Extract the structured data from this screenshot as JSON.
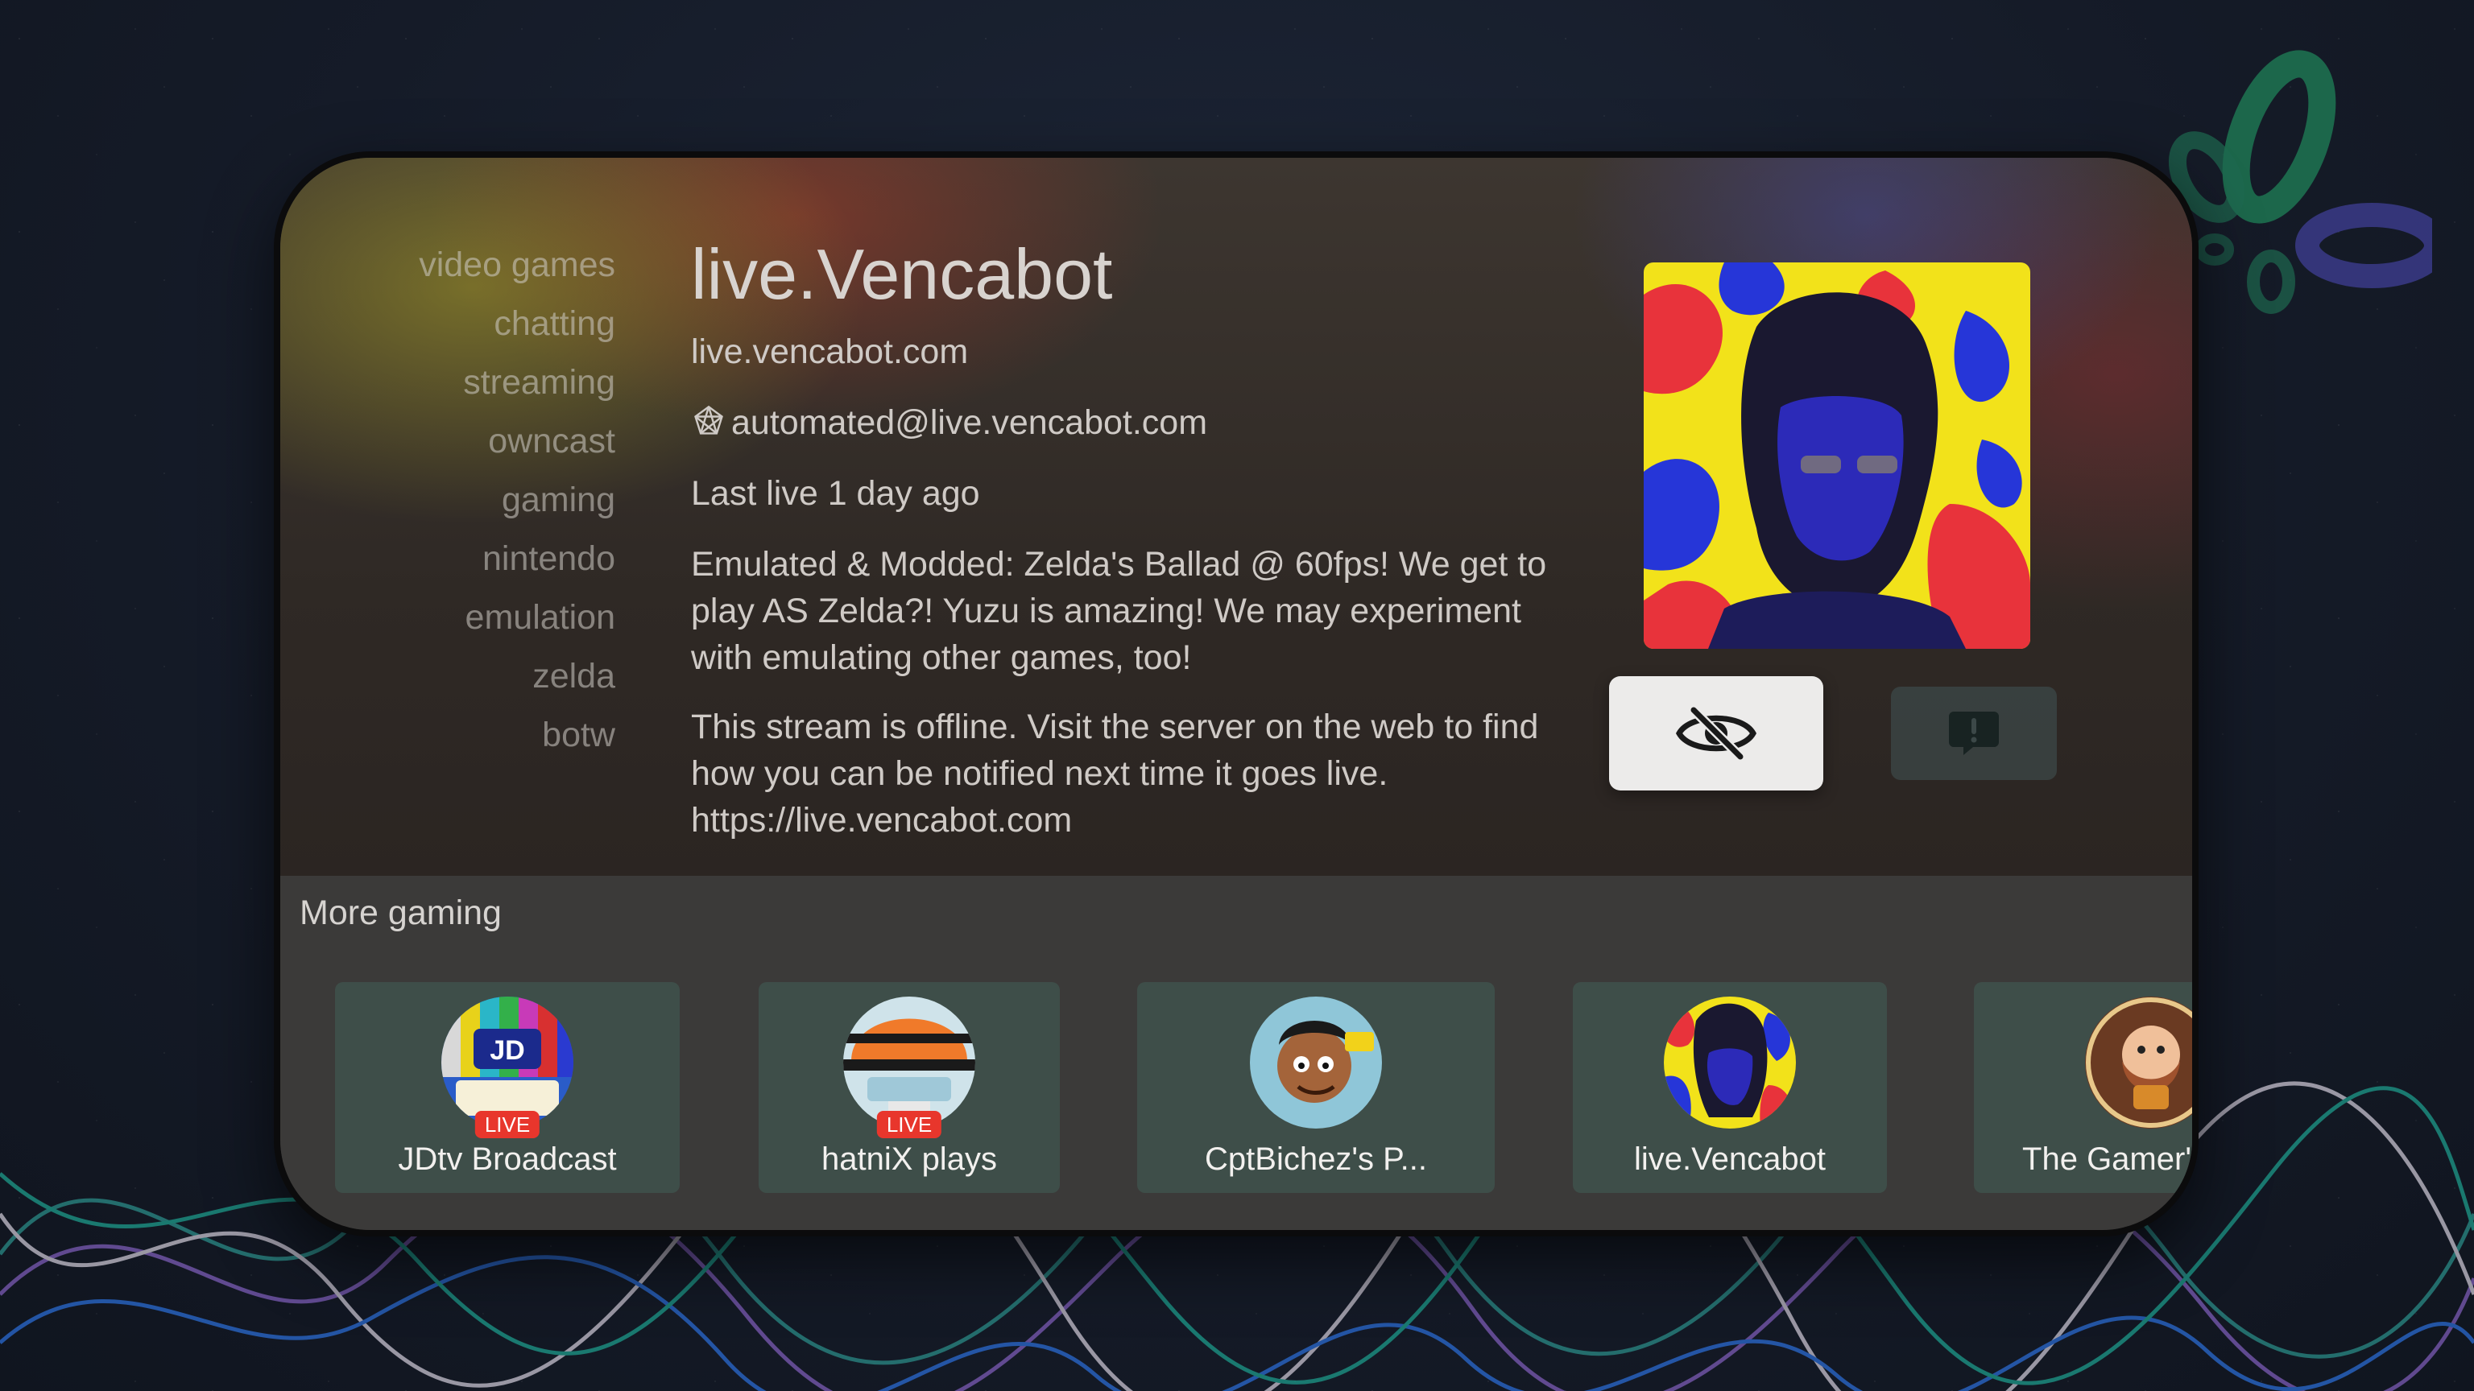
{
  "tags": [
    "video games",
    "chatting",
    "streaming",
    "owncast",
    "gaming",
    "nintendo",
    "emulation",
    "zelda",
    "botw"
  ],
  "stream": {
    "title": "live.Vencabot",
    "domain": "live.vencabot.com",
    "fediverse": "automated@live.vencabot.com",
    "last_live": "Last live 1 day ago",
    "description": "Emulated & Modded: Zelda's Ballad @ 60fps! We get to play AS Zelda?! Yuzu is amazing! We may experiment with emulating other games, too!",
    "offline_message": "This stream is offline. Visit the server on the web to find how you can be notified next time it goes live. https://live.vencabot.com"
  },
  "buttons": {
    "hide_icon": "eye-slash-icon",
    "report_icon": "report-bubble-icon"
  },
  "more": {
    "title": "More gaming",
    "cards": [
      {
        "label": "JDtv Broadcast",
        "live": "LIVE"
      },
      {
        "label": "hatniX plays",
        "live": "LIVE"
      },
      {
        "label": "CptBichez's P..."
      },
      {
        "label": "live.Vencabot"
      },
      {
        "label": "The Gamer'"
      }
    ]
  },
  "colors": {
    "live_badge": "#e8362c",
    "card_bg": "#3e4e49",
    "button_bg": "#ecebea"
  }
}
